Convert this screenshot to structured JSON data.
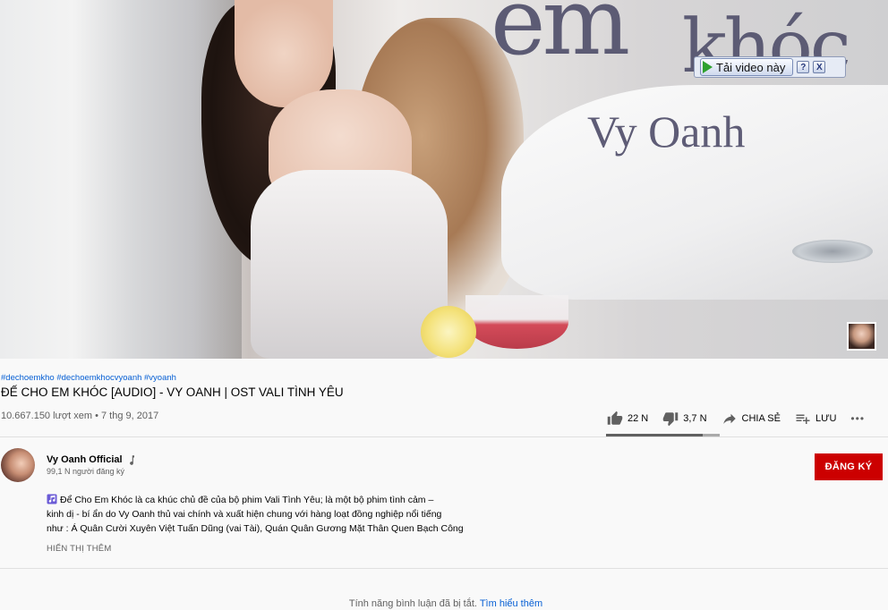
{
  "player": {
    "overlay_title_line1": "em",
    "overlay_title_line2": "khóc",
    "overlay_artist": "Vy Oanh",
    "download_label": "Tải video này",
    "help_label": "?",
    "close_label": "X"
  },
  "video": {
    "hashtags": "#dechoemkho #dechoemkhocvyoanh #vyoanh",
    "title": "ĐẾ CHO EM KHÓC [AUDIO] - VY OANH | OST VALI TÌNH YÊU",
    "views_date": "10.667.150 lượt xem • 7 thg 9, 2017"
  },
  "actions": {
    "like_count": "22 N",
    "dislike_count": "3,7 N",
    "share_label": "CHIA SẺ",
    "save_label": "LƯU",
    "more_label": "•••",
    "like_ratio": 0.85
  },
  "owner": {
    "name": "Vy Oanh Official",
    "verified_icon": "music-note-icon",
    "subscribers": "99,1 N người đăng ký",
    "subscribe_label": "ĐĂNG KÝ"
  },
  "description": {
    "line1": "Để Cho Em Khóc là ca khúc chủ đề của bộ phim Vali Tình Yêu; là một bộ phim tình cảm –",
    "line2": "kinh dị - bí ẩn do Vy Oanh thủ vai chính và xuất hiện chung với hàng loạt đồng nghiệp nổi tiếng",
    "line3": "như : Á Quân Cười Xuyên Việt Tuấn Dũng (vai Tài), Quán Quân Gương Mặt Thân Quen Bạch Công",
    "show_more": "HIỂN THỊ THÊM"
  },
  "comments": {
    "disabled_text": "Tính năng bình luận đã bị tắt.",
    "learn_more": "Tìm hiểu thêm"
  },
  "colors": {
    "subscribe": "#cc0000",
    "link": "#065fd4",
    "secondary_text": "#606060"
  }
}
